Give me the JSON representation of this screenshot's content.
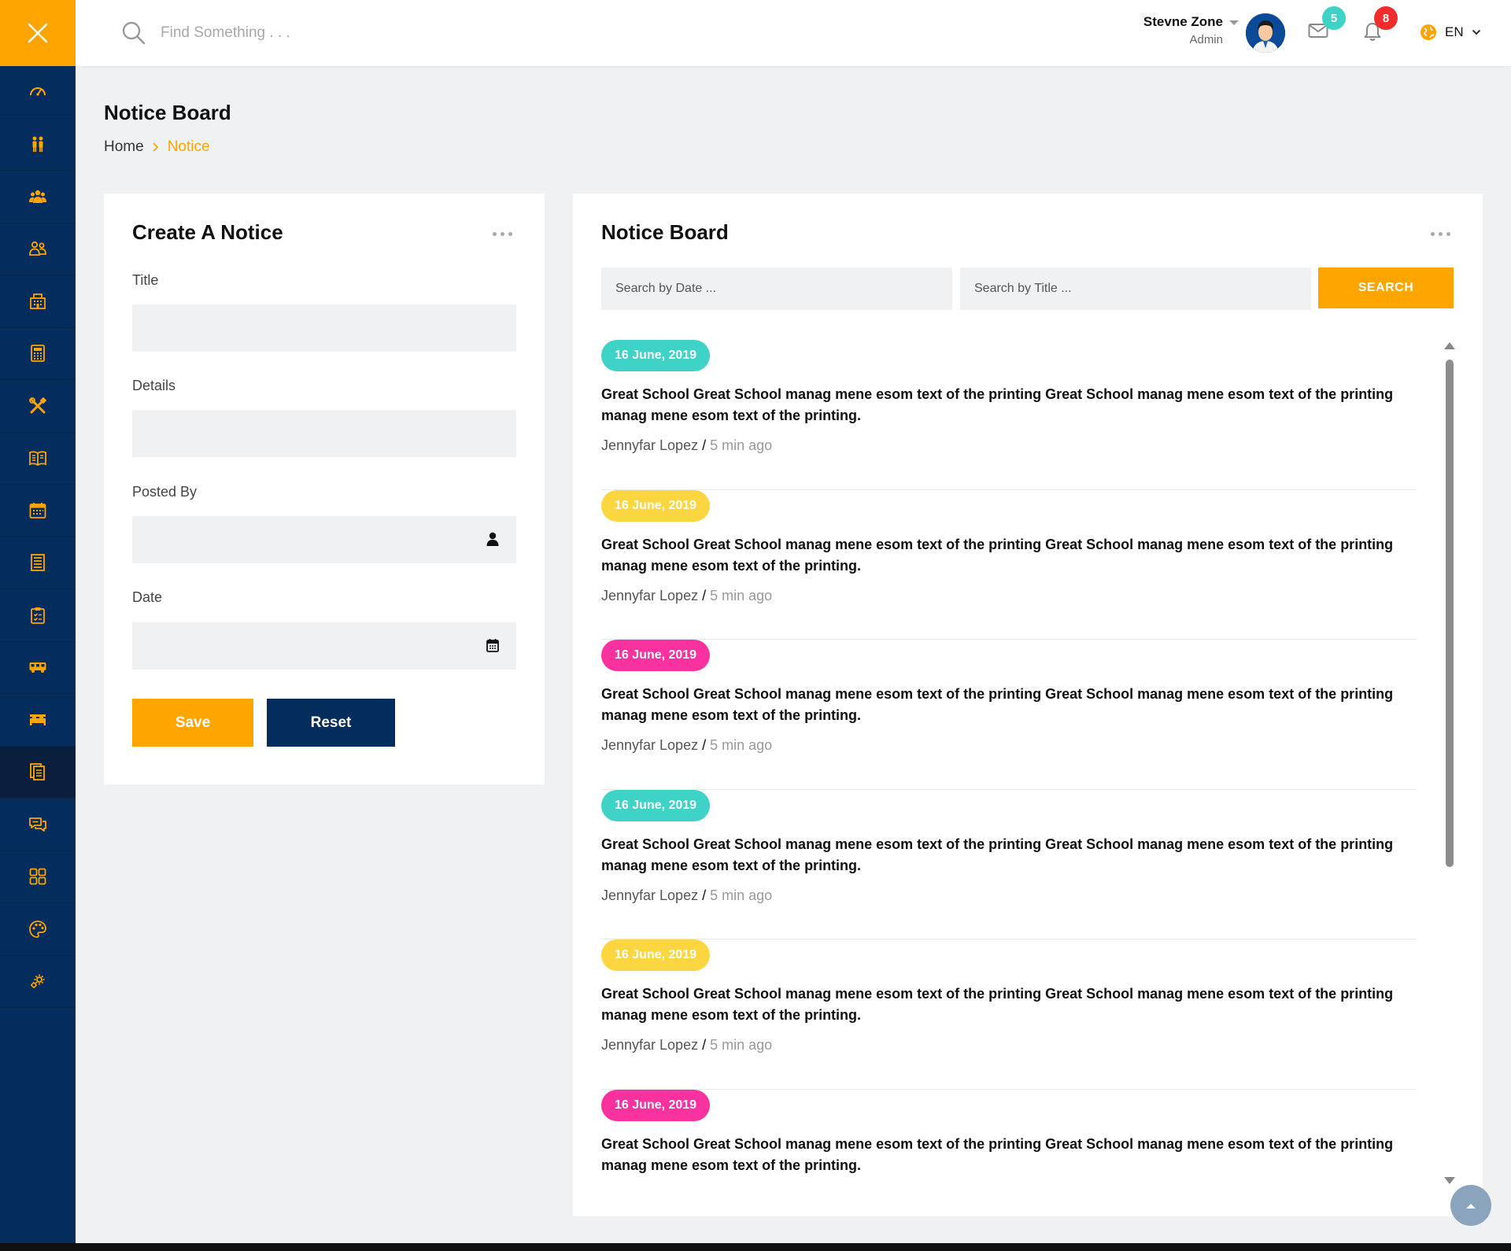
{
  "colors": {
    "accent": "#ffa500",
    "sidebar": "#042c5c",
    "navy_button": "#042c5c",
    "teal": "#3fd2c7",
    "yellow": "#fbd640",
    "pink": "#f9329f",
    "badge_red": "#f22c2c",
    "badge_teal": "#3fd2c7"
  },
  "sidebar": {
    "toggle_icon": "close-icon",
    "items": [
      {
        "icon": "dashboard-icon"
      },
      {
        "icon": "students-parents-icon"
      },
      {
        "icon": "group-icon"
      },
      {
        "icon": "teachers-icon"
      },
      {
        "icon": "building-icon"
      },
      {
        "icon": "calculator-icon"
      },
      {
        "icon": "tools-icon"
      },
      {
        "icon": "book-icon"
      },
      {
        "icon": "calendar-icon"
      },
      {
        "icon": "list-icon"
      },
      {
        "icon": "clipboard-icon"
      },
      {
        "icon": "bus-icon"
      },
      {
        "icon": "bed-icon"
      },
      {
        "icon": "notice-icon",
        "active": true
      },
      {
        "icon": "chat-icon"
      },
      {
        "icon": "grid-icon"
      },
      {
        "icon": "palette-icon"
      },
      {
        "icon": "settings-icon"
      }
    ]
  },
  "header": {
    "search_placeholder": "Find Something . . .",
    "user_name": "Stevne Zone",
    "user_role": "Admin",
    "messages_count": "5",
    "notifications_count": "8",
    "language": "EN"
  },
  "page": {
    "title": "Notice Board",
    "breadcrumb_home": "Home",
    "breadcrumb_current": "Notice"
  },
  "create_notice": {
    "title": "Create A Notice",
    "fields": {
      "title_label": "Title",
      "details_label": "Details",
      "posted_by_label": "Posted By",
      "date_label": "Date"
    },
    "save_label": "Save",
    "reset_label": "Reset"
  },
  "notice_board": {
    "title": "Notice Board",
    "date_placeholder": "Search by Date ...",
    "title_placeholder": "Search by Title ...",
    "search_label": "SEARCH",
    "notices": [
      {
        "date": "16 June, 2019",
        "color": "#3fd2c7",
        "text": "Great School Great School manag mene esom text of the printing Great School manag mene esom text of the printing manag mene esom text of the printing.",
        "author": "Jennyfar Lopez",
        "time": "5 min ago"
      },
      {
        "date": "16 June, 2019",
        "color": "#fbd640",
        "text": "Great School Great School manag mene esom text of the printing Great School manag mene esom text of the printing manag mene esom text of the printing.",
        "author": "Jennyfar Lopez",
        "time": "5 min ago"
      },
      {
        "date": "16 June, 2019",
        "color": "#f9329f",
        "text": "Great School Great School manag mene esom text of the printing Great School manag mene esom text of the printing manag mene esom text of the printing.",
        "author": "Jennyfar Lopez",
        "time": "5 min ago"
      },
      {
        "date": "16 June, 2019",
        "color": "#3fd2c7",
        "text": "Great School Great School manag mene esom text of the printing Great School manag mene esom text of the printing manag mene esom text of the printing.",
        "author": "Jennyfar Lopez",
        "time": "5 min ago"
      },
      {
        "date": "16 June, 2019",
        "color": "#fbd640",
        "text": "Great School Great School manag mene esom text of the printing Great School manag mene esom text of the printing manag mene esom text of the printing.",
        "author": "Jennyfar Lopez",
        "time": "5 min ago"
      },
      {
        "date": "16 June, 2019",
        "color": "#f9329f",
        "text": "Great School Great School manag mene esom text of the printing Great School manag mene esom text of the printing manag mene esom text of the printing.",
        "author": "",
        "time": ""
      }
    ]
  }
}
